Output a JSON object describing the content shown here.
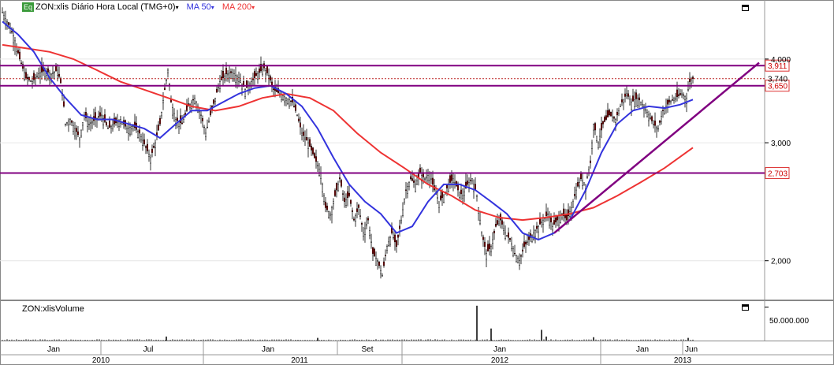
{
  "header": {
    "badge": "Eq",
    "symbol_title": "ZON:xlis Diário Hora Local (TMG+0)",
    "dropdown_glyph": "▾",
    "ma50_label": "MA 50",
    "ma200_label": "MA 200",
    "ma50_color": "#3333dd",
    "ma200_color": "#ee3333"
  },
  "volume_panel": {
    "title": "ZON:xlisVolume",
    "axis_label": "50.000.000"
  },
  "chart_data": {
    "type": "candlestick",
    "scale": "log",
    "ylim": [
      1.75,
      4.9
    ],
    "y_ticks": [
      "2,000",
      "3,000",
      "4,000"
    ],
    "y_tick_values": [
      2.0,
      3.0,
      4.0
    ],
    "x_month_labels": [
      "Jan",
      "Jul",
      "Jan",
      "Set",
      "Jan",
      "Jan",
      "Jun"
    ],
    "x_year_labels": [
      "2010",
      "2011",
      "2012",
      "2013"
    ],
    "horizontal_levels": [
      {
        "label": "3,911",
        "value": 3.911,
        "color": "#800080"
      },
      {
        "label": "3,650",
        "value": 3.65,
        "color": "#800080"
      },
      {
        "label": "2,703",
        "value": 2.703,
        "color": "#800080"
      }
    ],
    "last_price": {
      "label": "3,740",
      "value": 3.74
    },
    "price_path": [
      [
        0,
        4.7
      ],
      [
        8,
        4.5
      ],
      [
        15,
        4.3
      ],
      [
        22,
        4.0
      ],
      [
        30,
        3.75
      ],
      [
        38,
        3.7
      ],
      [
        46,
        3.8
      ],
      [
        54,
        3.85
      ],
      [
        62,
        3.8
      ],
      [
        70,
        3.85
      ],
      [
        76,
        3.6
      ],
      [
        80,
        3.2
      ],
      [
        86,
        3.25
      ],
      [
        92,
        3.15
      ],
      [
        98,
        3.05
      ],
      [
        104,
        3.3
      ],
      [
        110,
        3.2
      ],
      [
        118,
        3.25
      ],
      [
        126,
        3.3
      ],
      [
        134,
        3.15
      ],
      [
        142,
        3.2
      ],
      [
        150,
        3.25
      ],
      [
        158,
        3.15
      ],
      [
        166,
        3.18
      ],
      [
        174,
        3.1
      ],
      [
        182,
        2.95
      ],
      [
        188,
        2.85
      ],
      [
        194,
        3.0
      ],
      [
        200,
        3.2
      ],
      [
        206,
        3.6
      ],
      [
        210,
        3.85
      ],
      [
        214,
        3.45
      ],
      [
        220,
        3.25
      ],
      [
        228,
        3.2
      ],
      [
        236,
        3.4
      ],
      [
        244,
        3.5
      ],
      [
        252,
        3.3
      ],
      [
        258,
        3.1
      ],
      [
        264,
        3.3
      ],
      [
        270,
        3.5
      ],
      [
        276,
        3.7
      ],
      [
        284,
        3.8
      ],
      [
        292,
        3.82
      ],
      [
        300,
        3.75
      ],
      [
        308,
        3.6
      ],
      [
        316,
        3.7
      ],
      [
        324,
        3.8
      ],
      [
        332,
        3.88
      ],
      [
        338,
        3.78
      ],
      [
        344,
        3.6
      ],
      [
        352,
        3.55
      ],
      [
        360,
        3.5
      ],
      [
        368,
        3.45
      ],
      [
        374,
        3.3
      ],
      [
        380,
        3.1
      ],
      [
        388,
        3.0
      ],
      [
        396,
        2.85
      ],
      [
        404,
        2.7
      ],
      [
        410,
        2.4
      ],
      [
        416,
        2.35
      ],
      [
        422,
        2.5
      ],
      [
        428,
        2.65
      ],
      [
        434,
        2.45
      ],
      [
        440,
        2.5
      ],
      [
        446,
        2.3
      ],
      [
        452,
        2.4
      ],
      [
        458,
        2.2
      ],
      [
        464,
        2.3
      ],
      [
        470,
        2.05
      ],
      [
        476,
        2.0
      ],
      [
        482,
        1.9
      ],
      [
        488,
        2.1
      ],
      [
        494,
        2.2
      ],
      [
        500,
        2.1
      ],
      [
        506,
        2.3
      ],
      [
        512,
        2.55
      ],
      [
        518,
        2.65
      ],
      [
        524,
        2.6
      ],
      [
        530,
        2.7
      ],
      [
        536,
        2.65
      ],
      [
        542,
        2.7
      ],
      [
        548,
        2.55
      ],
      [
        554,
        2.45
      ],
      [
        560,
        2.5
      ],
      [
        566,
        2.6
      ],
      [
        572,
        2.65
      ],
      [
        578,
        2.55
      ],
      [
        584,
        2.5
      ],
      [
        590,
        2.6
      ],
      [
        596,
        2.65
      ],
      [
        602,
        2.5
      ],
      [
        608,
        2.2
      ],
      [
        614,
        2.05
      ],
      [
        620,
        2.1
      ],
      [
        626,
        2.25
      ],
      [
        632,
        2.3
      ],
      [
        638,
        2.2
      ],
      [
        644,
        2.15
      ],
      [
        650,
        2.05
      ],
      [
        656,
        2.0
      ],
      [
        662,
        2.1
      ],
      [
        668,
        2.15
      ],
      [
        674,
        2.2
      ],
      [
        680,
        2.25
      ],
      [
        686,
        2.3
      ],
      [
        692,
        2.35
      ],
      [
        698,
        2.25
      ],
      [
        704,
        2.3
      ],
      [
        710,
        2.35
      ],
      [
        716,
        2.3
      ],
      [
        722,
        2.4
      ],
      [
        728,
        2.55
      ],
      [
        734,
        2.65
      ],
      [
        740,
        2.6
      ],
      [
        746,
        2.8
      ],
      [
        750,
        3.2
      ],
      [
        756,
        3.0
      ],
      [
        762,
        3.2
      ],
      [
        770,
        3.3
      ],
      [
        778,
        3.25
      ],
      [
        786,
        3.45
      ],
      [
        792,
        3.55
      ],
      [
        798,
        3.45
      ],
      [
        806,
        3.5
      ],
      [
        814,
        3.4
      ],
      [
        820,
        3.3
      ],
      [
        826,
        3.2
      ],
      [
        832,
        3.15
      ],
      [
        838,
        3.35
      ],
      [
        846,
        3.45
      ],
      [
        854,
        3.5
      ],
      [
        862,
        3.55
      ],
      [
        868,
        3.5
      ],
      [
        872,
        3.7
      ],
      [
        876,
        3.74
      ]
    ],
    "ma50_path": [
      [
        0,
        4.55
      ],
      [
        20,
        4.35
      ],
      [
        40,
        4.1
      ],
      [
        60,
        3.75
      ],
      [
        80,
        3.5
      ],
      [
        100,
        3.3
      ],
      [
        120,
        3.25
      ],
      [
        140,
        3.25
      ],
      [
        160,
        3.2
      ],
      [
        180,
        3.15
      ],
      [
        200,
        3.05
      ],
      [
        220,
        3.2
      ],
      [
        240,
        3.35
      ],
      [
        260,
        3.35
      ],
      [
        280,
        3.45
      ],
      [
        300,
        3.55
      ],
      [
        320,
        3.62
      ],
      [
        340,
        3.65
      ],
      [
        360,
        3.55
      ],
      [
        380,
        3.4
      ],
      [
        400,
        3.15
      ],
      [
        420,
        2.85
      ],
      [
        440,
        2.6
      ],
      [
        460,
        2.45
      ],
      [
        480,
        2.35
      ],
      [
        500,
        2.2
      ],
      [
        520,
        2.25
      ],
      [
        540,
        2.45
      ],
      [
        560,
        2.6
      ],
      [
        580,
        2.6
      ],
      [
        600,
        2.55
      ],
      [
        620,
        2.45
      ],
      [
        640,
        2.35
      ],
      [
        660,
        2.2
      ],
      [
        680,
        2.15
      ],
      [
        700,
        2.2
      ],
      [
        720,
        2.3
      ],
      [
        740,
        2.55
      ],
      [
        760,
        2.9
      ],
      [
        780,
        3.2
      ],
      [
        800,
        3.35
      ],
      [
        820,
        3.4
      ],
      [
        840,
        3.38
      ],
      [
        860,
        3.42
      ],
      [
        876,
        3.48
      ]
    ],
    "ma200_path": [
      [
        0,
        4.2
      ],
      [
        30,
        4.15
      ],
      [
        60,
        4.1
      ],
      [
        90,
        4.0
      ],
      [
        120,
        3.85
      ],
      [
        150,
        3.7
      ],
      [
        180,
        3.6
      ],
      [
        210,
        3.5
      ],
      [
        240,
        3.4
      ],
      [
        270,
        3.35
      ],
      [
        300,
        3.4
      ],
      [
        330,
        3.5
      ],
      [
        360,
        3.55
      ],
      [
        390,
        3.5
      ],
      [
        420,
        3.35
      ],
      [
        450,
        3.1
      ],
      [
        480,
        2.9
      ],
      [
        510,
        2.75
      ],
      [
        540,
        2.6
      ],
      [
        570,
        2.5
      ],
      [
        600,
        2.38
      ],
      [
        630,
        2.32
      ],
      [
        660,
        2.3
      ],
      [
        690,
        2.32
      ],
      [
        720,
        2.35
      ],
      [
        750,
        2.4
      ],
      [
        780,
        2.5
      ],
      [
        810,
        2.62
      ],
      [
        840,
        2.75
      ],
      [
        876,
        2.95
      ]
    ],
    "trendline": [
      [
        700,
        2.2
      ],
      [
        960,
        3.95
      ]
    ],
    "volume_spikes": [
      [
        208,
        6
      ],
      [
        400,
        4
      ],
      [
        602,
        52
      ],
      [
        620,
        18
      ],
      [
        684,
        16
      ],
      [
        690,
        6
      ],
      [
        750,
        5
      ],
      [
        870,
        4
      ]
    ]
  }
}
